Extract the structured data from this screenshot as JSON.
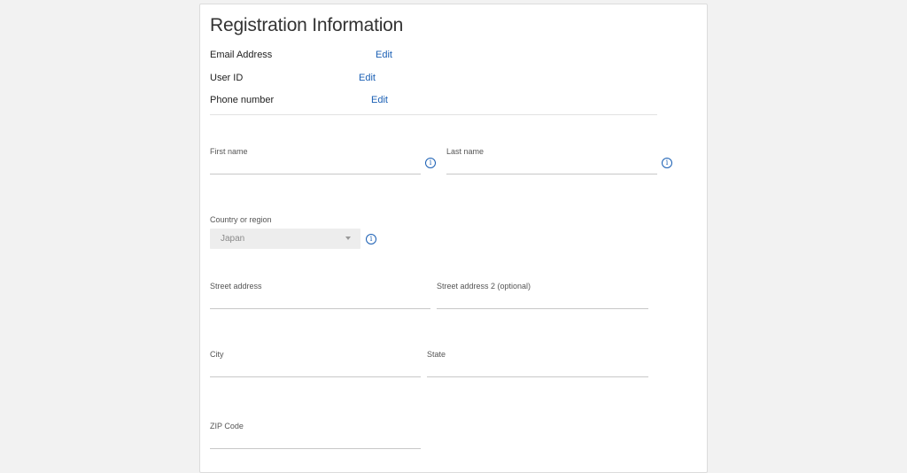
{
  "form": {
    "title": "Registration Information",
    "account_info": [
      {
        "label": "Email Address",
        "edit_label": "Edit"
      },
      {
        "label": "User ID",
        "edit_label": "Edit"
      },
      {
        "label": "Phone number",
        "edit_label": "Edit"
      }
    ],
    "fields": {
      "first_name": {
        "label": "First name",
        "value": "",
        "info_icon": "info-circle-icon"
      },
      "last_name": {
        "label": "Last name",
        "value": "",
        "info_icon": "info-circle-icon"
      },
      "country": {
        "label": "Country or region",
        "selected": "Japan",
        "info_icon": "info-circle-icon"
      },
      "street_address": {
        "label": "Street address",
        "value": ""
      },
      "street_address_2": {
        "label": "Street address 2 (optional)",
        "value": ""
      },
      "city": {
        "label": "City",
        "value": ""
      },
      "state": {
        "label": "State",
        "value": ""
      },
      "zip_code": {
        "label": "ZIP Code",
        "value": ""
      }
    }
  },
  "colors": {
    "link": "#1a5fb4",
    "background": "#f2f2f2",
    "card": "#ffffff"
  }
}
